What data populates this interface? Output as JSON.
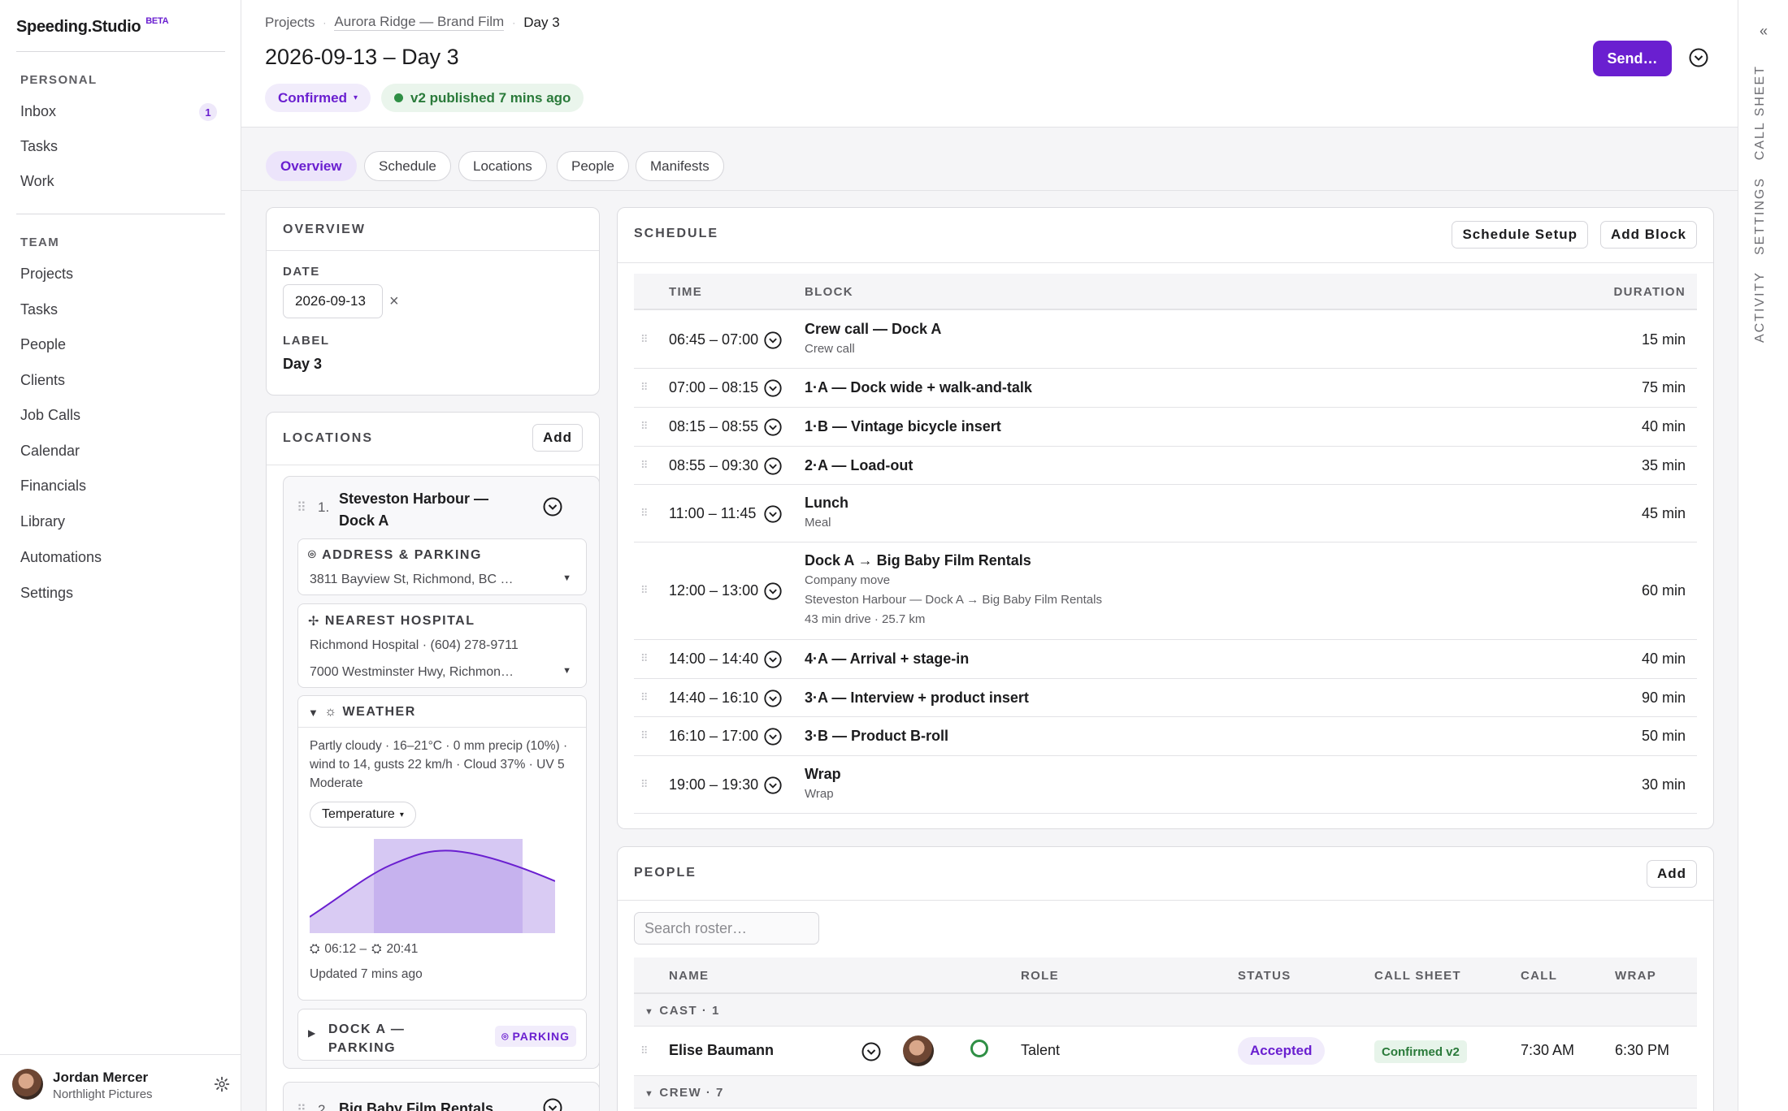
{
  "app": {
    "name": "Speeding.Studio",
    "badge": "BETA"
  },
  "sidebar": {
    "personal_heading": "PERSONAL",
    "personal": [
      {
        "label": "Inbox",
        "badge": "1"
      },
      {
        "label": "Tasks"
      },
      {
        "label": "Work"
      }
    ],
    "team_heading": "TEAM",
    "team": [
      {
        "label": "Projects"
      },
      {
        "label": "Tasks"
      },
      {
        "label": "People"
      },
      {
        "label": "Clients"
      },
      {
        "label": "Job Calls"
      },
      {
        "label": "Calendar"
      },
      {
        "label": "Financials"
      },
      {
        "label": "Library"
      },
      {
        "label": "Automations"
      },
      {
        "label": "Settings"
      }
    ],
    "user": {
      "name": "Jordan Mercer",
      "org": "Northlight Pictures"
    }
  },
  "header": {
    "breadcrumbs": [
      "Projects",
      "Aurora Ridge — Brand Film",
      "Day 3"
    ],
    "title": "2026-09-13 – Day 3",
    "status": "Confirmed",
    "published": "v2 published 7 mins ago",
    "send_label": "Send…"
  },
  "rail": {
    "collapse": "«",
    "tabs": [
      "CALL SHEET",
      "SETTINGS",
      "ACTIVITY"
    ]
  },
  "tabs": [
    "Overview",
    "Schedule",
    "Locations",
    "People",
    "Manifests"
  ],
  "overview": {
    "title": "OVERVIEW",
    "date_label": "DATE",
    "date_value": "2026-09-13",
    "label_label": "LABEL",
    "label_value": "Day 3"
  },
  "locations": {
    "title": "LOCATIONS",
    "add_label": "Add",
    "items": [
      {
        "index": "1.",
        "name_line1": "Steveston Harbour —",
        "name_line2": "Dock A",
        "address_heading": "ADDRESS & PARKING",
        "address": "3811 Bayview St, Richmond, BC …",
        "hospital_heading": "NEAREST HOSPITAL",
        "hospital_line1": "Richmond Hospital · (604) 278-9711",
        "hospital_line2": "7000 Westminster Hwy, Richmon…",
        "weather_heading": "WEATHER",
        "weather_desc": "Partly cloudy · 16–21°C · 0 mm precip (10%) · wind to 14, gusts 22 km/h · Cloud 37% · UV 5 Moderate",
        "weather_metric": "Temperature",
        "sunrise": "06:12 –",
        "sunset": "20:41",
        "updated": "Updated 7 mins ago",
        "parking_line1": "DOCK A —",
        "parking_line2": "PARKING",
        "parking_badge": "PARKING"
      },
      {
        "index": "2.",
        "name_line1": "Big Baby Film Rentals"
      }
    ]
  },
  "schedule": {
    "title": "SCHEDULE",
    "setup_label": "Schedule Setup",
    "add_label": "Add Block",
    "columns": {
      "time": "TIME",
      "block": "BLOCK",
      "duration": "DURATION"
    },
    "rows": [
      {
        "time": "06:45 – 07:00",
        "block": "Crew call — Dock A",
        "sub": "Crew call",
        "duration": "15 min"
      },
      {
        "time": "07:00 – 08:15",
        "block": "1·A — Dock wide + walk-and-talk",
        "duration": "75 min"
      },
      {
        "time": "08:15 – 08:55",
        "block": "1·B — Vintage bicycle insert",
        "duration": "40 min"
      },
      {
        "time": "08:55 – 09:30",
        "block": "2·A — Load-out",
        "duration": "35 min"
      },
      {
        "time": "11:00 – 11:45",
        "block": "Lunch",
        "sub": "Meal",
        "duration": "45 min"
      },
      {
        "time": "12:00 – 13:00",
        "block": "Dock A → Big Baby Film Rentals",
        "sub": "Company move",
        "sub2": "Steveston Harbour — Dock A → Big Baby Film Rentals",
        "sub3": "43 min drive · 25.7 km",
        "duration": "60 min"
      },
      {
        "time": "14:00 – 14:40",
        "block": "4·A — Arrival + stage-in",
        "duration": "40 min"
      },
      {
        "time": "14:40 – 16:10",
        "block": "3·A — Interview + product insert",
        "duration": "90 min"
      },
      {
        "time": "16:10 – 17:00",
        "block": "3·B — Product B-roll",
        "duration": "50 min"
      },
      {
        "time": "19:00 – 19:30",
        "block": "Wrap",
        "sub": "Wrap",
        "duration": "30 min"
      }
    ]
  },
  "people": {
    "title": "PEOPLE",
    "add_label": "Add",
    "search_placeholder": "Search roster…",
    "columns": {
      "name": "NAME",
      "role": "ROLE",
      "status": "STATUS",
      "call_sheet": "CALL SHEET",
      "call": "CALL",
      "wrap": "WRAP"
    },
    "groups": [
      {
        "label": "CAST · 1",
        "rows": [
          {
            "name": "Elise Baumann",
            "role": "Talent",
            "status": "Accepted",
            "call_sheet": "Confirmed v2",
            "call": "7:30 AM",
            "wrap": "6:30 PM"
          }
        ]
      },
      {
        "label": "CREW · 7"
      }
    ]
  },
  "colors": {
    "accent": "#6a1fd0",
    "success": "#2f8f45"
  }
}
